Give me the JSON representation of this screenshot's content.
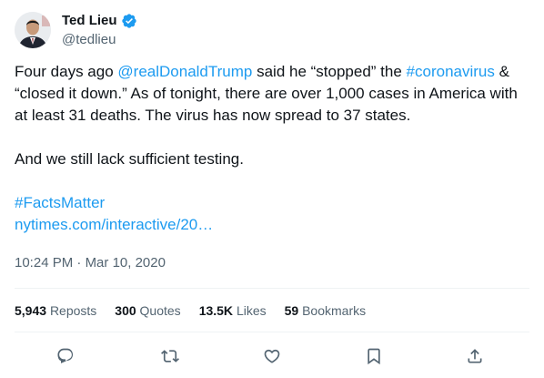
{
  "author": {
    "display_name": "Ted Lieu",
    "handle": "@tedlieu",
    "verified": true
  },
  "tweet": {
    "line1_pre": "Four days ago ",
    "mention": "@realDonaldTrump",
    "line1_mid": " said he “stopped” the ",
    "hashtag1": "#coronavirus",
    "line1_post": " & “closed it down.” As of tonight, there are over 1,000 cases in America with at least 31 deaths. The virus has now spread to 37 states.",
    "paragraph2": "And we still lack sufficient testing.",
    "hashtag2": "#FactsMatter",
    "link": "nytimes.com/interactive/20…"
  },
  "timestamp": {
    "time": "10:24 PM",
    "separator": " · ",
    "date": "Mar 10, 2020"
  },
  "stats": {
    "reposts_count": "5,943",
    "reposts_label": "Reposts",
    "quotes_count": "300",
    "quotes_label": "Quotes",
    "likes_count": "13.5K",
    "likes_label": "Likes",
    "bookmarks_count": "59",
    "bookmarks_label": "Bookmarks"
  },
  "actions": [
    "reply-icon",
    "repost-icon",
    "like-icon",
    "bookmark-icon",
    "share-icon"
  ],
  "colors": {
    "link": "#1d9bf0",
    "text": "#0f1419",
    "secondary": "#536471",
    "divider": "#eff3f4"
  }
}
